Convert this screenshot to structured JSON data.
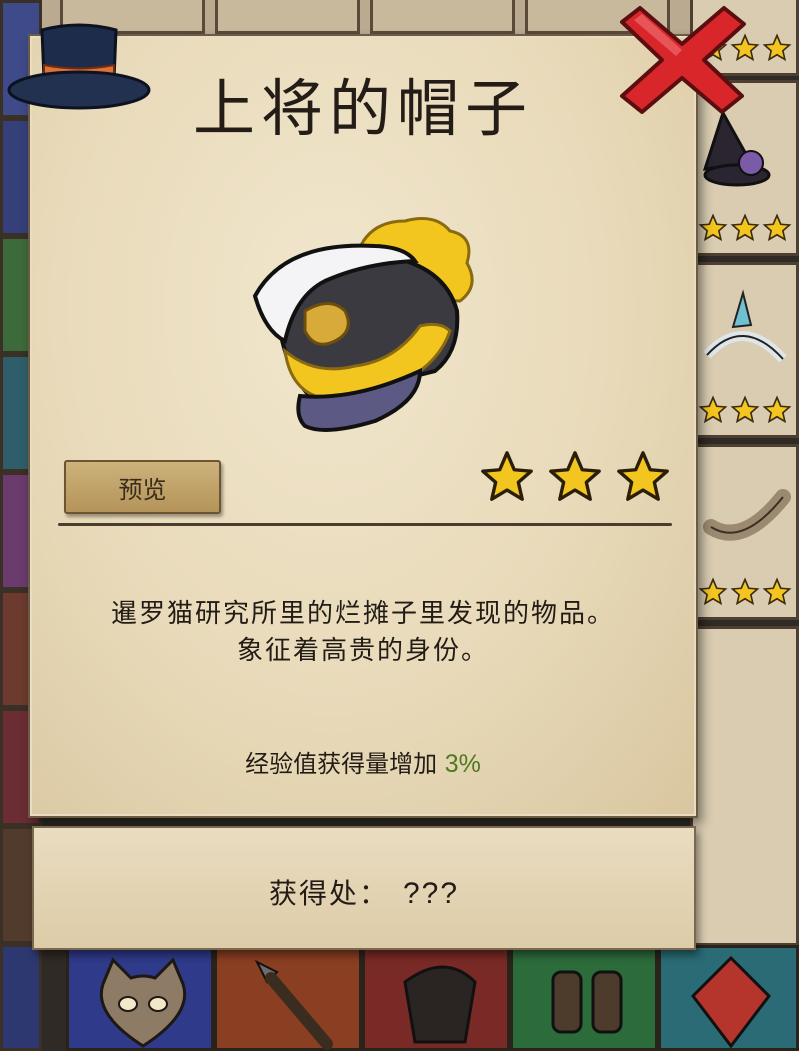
{
  "card": {
    "title": "上将的帽子",
    "rarity": 3,
    "preview_label": "预览",
    "description_line1": "暹罗猫研究所里的烂摊子里发现的物品。",
    "description_line2": "象征着高贵的身份。",
    "effect_label": "经验值获得量增加",
    "effect_value": "3%"
  },
  "source": {
    "label": "获得处：",
    "value": "???"
  },
  "colors": {
    "parchment": "#e8dab9",
    "star_fill": "#f3c51f",
    "bonus_green": "#4f7a1e",
    "close_red": "#d8262b"
  },
  "icons": {
    "close": "close-x-icon",
    "star": "star-icon",
    "item": "admiral-hat-icon"
  }
}
